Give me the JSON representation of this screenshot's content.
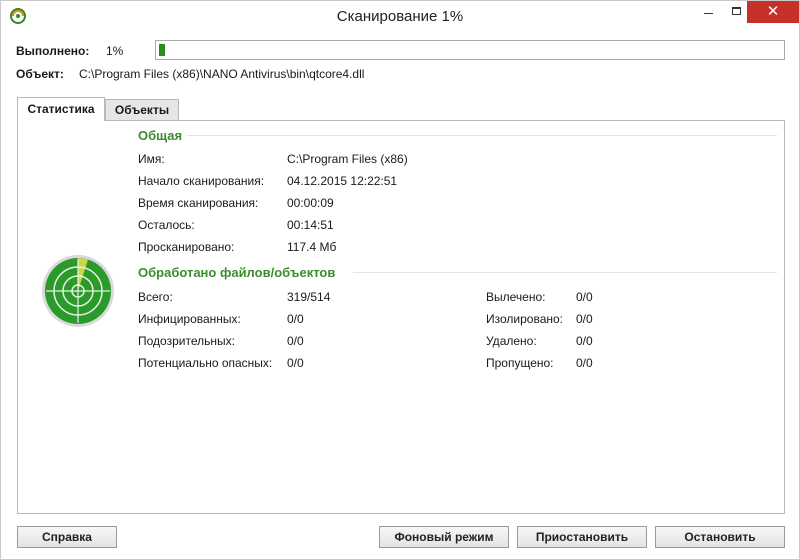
{
  "window": {
    "title": "Сканирование 1%"
  },
  "progress": {
    "label": "Выполнено:",
    "percent_text": "1%",
    "value": 0.01
  },
  "object": {
    "label": "Объект:",
    "path": "C:\\Program Files (x86)\\NANO Antivirus\\bin\\qtcore4.dll"
  },
  "tabs": [
    {
      "label": "Статистика"
    },
    {
      "label": "Объекты"
    }
  ],
  "general": {
    "title": "Общая",
    "rows": [
      {
        "label": "Имя:",
        "value": "C:\\Program Files (x86)"
      },
      {
        "label": "Начало сканирования:",
        "value": "04.12.2015 12:22:51"
      },
      {
        "label": "Время сканирования:",
        "value": "00:00:09"
      },
      {
        "label": "Осталось:",
        "value": "00:14:51"
      },
      {
        "label": "Просканировано:",
        "value": "117.4 Мб"
      }
    ]
  },
  "processed": {
    "title": "Обработано файлов/объектов",
    "left": [
      {
        "label": "Всего:",
        "value": "319/514"
      },
      {
        "label": "Инфицированных:",
        "value": "0/0"
      },
      {
        "label": "Подозрительных:",
        "value": "0/0"
      },
      {
        "label": "Потенциально опасных:",
        "value": "0/0"
      }
    ],
    "right": [
      {
        "label": "Вылечено:",
        "value": "0/0"
      },
      {
        "label": "Изолировано:",
        "value": "0/0"
      },
      {
        "label": "Удалено:",
        "value": "0/0"
      },
      {
        "label": "Пропущено:",
        "value": "0/0"
      }
    ]
  },
  "buttons": {
    "help": "Справка",
    "background": "Фоновый режим",
    "pause": "Приостановить",
    "stop": "Остановить"
  },
  "icons": {
    "app": "nano-antivirus-icon",
    "radar": "radar-icon"
  },
  "colors": {
    "accent_green": "#3a8e2c",
    "progress_fill": "#2e8b1f",
    "close_red": "#c7302a"
  }
}
